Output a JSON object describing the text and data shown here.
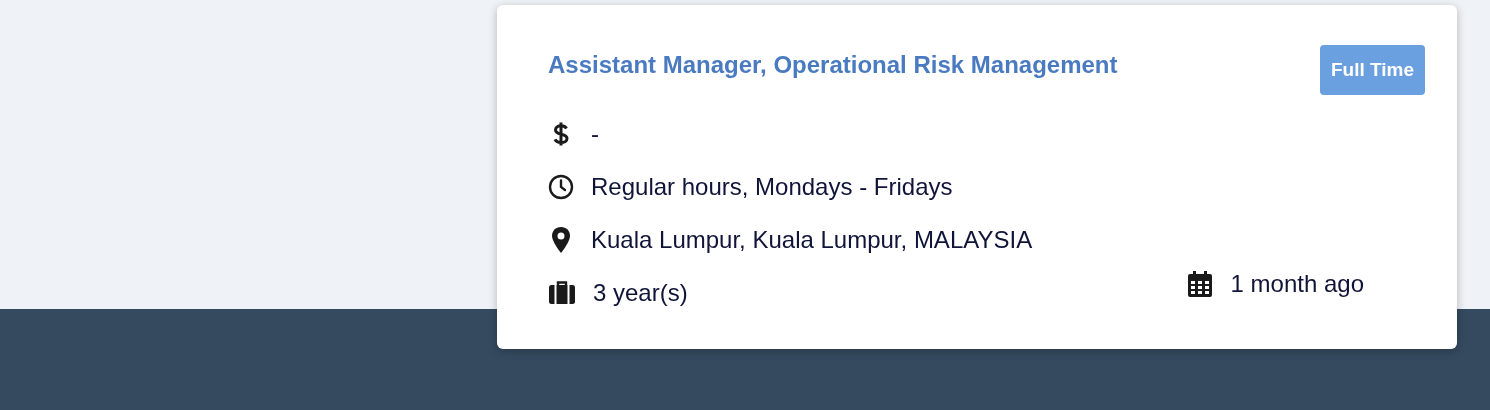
{
  "job": {
    "title": "Assistant Manager, Operational Risk Management",
    "badge": "Full Time",
    "details": [
      {
        "kind": "salary",
        "text": "-"
      },
      {
        "kind": "hours",
        "text": "Regular hours, Mondays - Fridays"
      },
      {
        "kind": "location",
        "text": "Kuala Lumpur, Kuala Lumpur, MALAYSIA"
      },
      {
        "kind": "experience",
        "text": "3 year(s)"
      }
    ],
    "posted": "1 month ago"
  }
}
